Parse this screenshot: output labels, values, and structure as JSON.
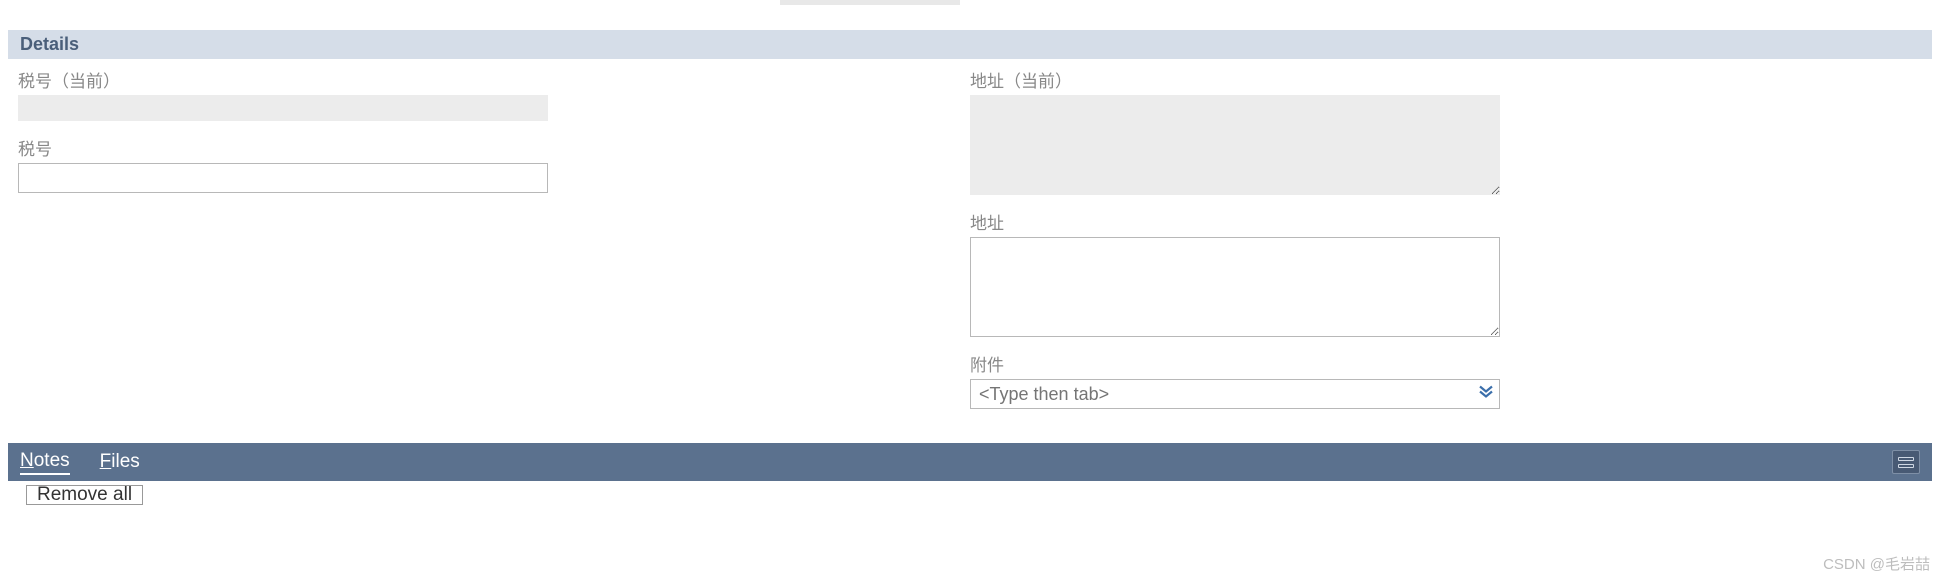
{
  "section": {
    "title": "Details"
  },
  "fields": {
    "tax_current_label": "税号（当前）",
    "tax_current_value": "",
    "tax_label": "税号",
    "tax_value": "",
    "address_current_label": "地址（当前）",
    "address_current_value": "",
    "address_label": "地址",
    "address_value": "",
    "attachment_label": "附件",
    "attachment_placeholder": "<Type then tab>"
  },
  "bottom": {
    "tab_notes": "Notes",
    "tab_files": "Files",
    "remove_all": "Remove all"
  },
  "watermark": "CSDN @毛岩喆"
}
